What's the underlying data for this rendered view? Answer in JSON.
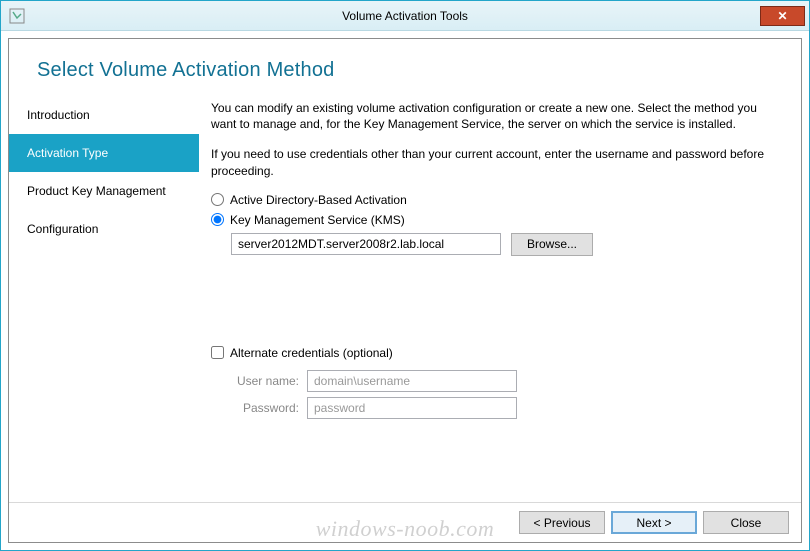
{
  "window": {
    "title": "Volume Activation Tools",
    "close_glyph": "✕"
  },
  "header": {
    "title": "Select Volume Activation Method"
  },
  "nav": {
    "items": [
      {
        "label": "Introduction",
        "selected": false
      },
      {
        "label": "Activation Type",
        "selected": true
      },
      {
        "label": "Product Key Management",
        "selected": false
      },
      {
        "label": "Configuration",
        "selected": false
      }
    ]
  },
  "content": {
    "para1": "You can modify an existing volume activation configuration or create a new one. Select the method you want to manage and, for the Key Management Service, the server on which the service is installed.",
    "para2": "If you need to use credentials other than your current account, enter the username and password before proceeding.",
    "radio_adba": "Active Directory-Based Activation",
    "radio_kms": "Key Management Service (KMS)",
    "selected_method": "kms",
    "server_value": "server2012MDT.server2008r2.lab.local",
    "browse_label": "Browse...",
    "alt_cred_label": "Alternate credentials (optional)",
    "alt_cred_checked": false,
    "username_label": "User name:",
    "username_placeholder": "domain\\username",
    "username_value": "",
    "password_label": "Password:",
    "password_placeholder": "password",
    "password_value": ""
  },
  "footer": {
    "previous": "<  Previous",
    "next": "Next  >",
    "close": "Close"
  },
  "watermark": "windows-noob.com"
}
